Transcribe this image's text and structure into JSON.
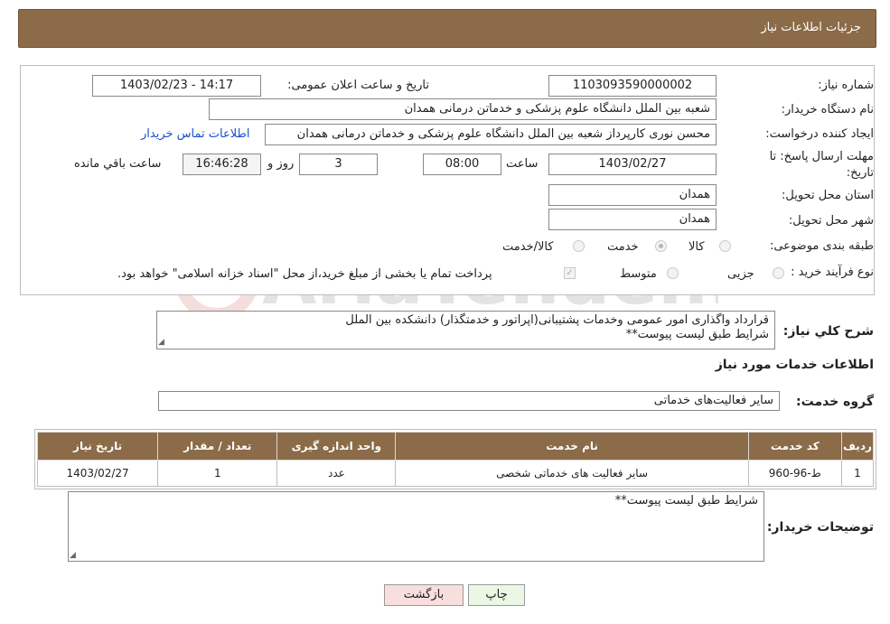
{
  "header": {
    "title": "جزئیات اطلاعات نیاز"
  },
  "fields": {
    "need_number_label": "شماره نیاز:",
    "need_number": "1103093590000002",
    "announce_label": "تاریخ و ساعت اعلان عمومی:",
    "announce_value": "1403/02/23 - 14:17",
    "buyer_org_label": "نام دستگاه خریدار:",
    "buyer_org": "شعبه بین الملل دانشگاه علوم پزشکی و خدماتن درمانی همدان",
    "creator_label": "ایجاد کننده درخواست:",
    "creator": "محسن نوری کارپرداز شعبه بین الملل دانشگاه علوم پزشکی و خدماتن درمانی همدان",
    "contact_link": "اطلاعات تماس خریدار",
    "deadline_label_1": "مهلت ارسال پاسخ: تا",
    "deadline_label_2": "تاریخ:",
    "deadline_date": "1403/02/27",
    "time_label": "ساعت",
    "deadline_time": "08:00",
    "days_value": "3",
    "days_label": "روز و",
    "remaining_time": "16:46:28",
    "remaining_label": "ساعت باقي مانده",
    "province_label": "استان محل تحویل:",
    "province": "همدان",
    "city_label": "شهر محل تحویل:",
    "city": "همدان",
    "category_label": "طبقه بندی موضوعی:",
    "category_options": [
      "کالا",
      "خدمت",
      "کالا/خدمت"
    ],
    "category_selected": "خدمت",
    "process_label": "نوع فرآیند خرید :",
    "process_options": [
      "جزیی",
      "متوسط"
    ],
    "payment_note": "پرداخت تمام یا بخشی از مبلغ خرید،از محل \"اسناد خزانه اسلامی\" خواهد بود."
  },
  "description": {
    "label": "شرح کلي نياز:",
    "line1": "قرارداد واگذاری امور عمومی وخدمات پشتیبانی(اپراتور و خدمتگذار) دانشکده بین الملل",
    "line2": "شرایط طبق لیست پیوست**"
  },
  "services": {
    "section_title": "اطلاعات خدمات مورد نياز",
    "group_label": "گروه خدمت:",
    "group_value": "سایر فعالیت‌های خدماتی",
    "columns": [
      "ردیف",
      "کد خدمت",
      "نام خدمت",
      "واحد اندازه گیری",
      "تعداد / مقدار",
      "تاریخ نیاز"
    ],
    "rows": [
      [
        "1",
        "ط-96-960",
        "سایر فعالیت های خدماتی شخصی",
        "عدد",
        "1",
        "1403/02/27"
      ]
    ]
  },
  "buyer_notes": {
    "label": "توضيحات خريدار:",
    "text": "شرایط طبق لیست پیوست**"
  },
  "buttons": {
    "print": "چاپ",
    "back": "بازگشت"
  },
  "watermark": "AriaTender.neT",
  "colors": {
    "header": "#8b6b48",
    "link": "#1a4fd1",
    "back_button": "#f9dede",
    "print_button": "#eaf7e4"
  }
}
